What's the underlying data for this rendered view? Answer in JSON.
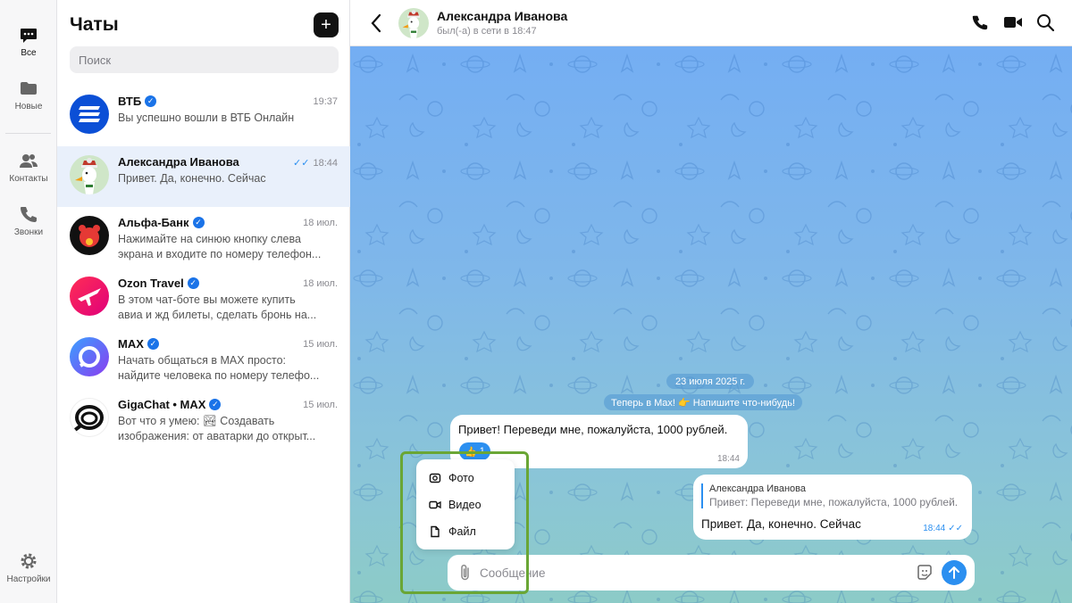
{
  "rail": {
    "items": [
      {
        "label": "Все",
        "icon": "chat-bubble-icon"
      },
      {
        "label": "Новые",
        "icon": "folder-icon"
      },
      {
        "label": "Контакты",
        "icon": "contacts-icon"
      },
      {
        "label": "Звонки",
        "icon": "phone-icon"
      }
    ],
    "settings_label": "Настройки"
  },
  "chats": {
    "title": "Чаты",
    "new_chat_symbol": "+",
    "search_placeholder": "Поиск",
    "items": [
      {
        "name": "ВТБ",
        "time": "19:37",
        "preview": "Вы успешно вошли в ВТБ Онлайн",
        "verified": true
      },
      {
        "name": "Александра Иванова",
        "time": "18:44",
        "preview": "Привет. Да, конечно. Сейчас",
        "verified": false,
        "read": true
      },
      {
        "name": "Альфа-Банк",
        "time": "18 июл.",
        "preview": "Нажимайте на синюю кнопку слева\nэкрана и входите по номеру телефон...",
        "verified": true
      },
      {
        "name": "Ozon Travel",
        "time": "18 июл.",
        "preview": "В этом чат-боте вы можете купить\nавиа и жд билеты, сделать бронь на...",
        "verified": true
      },
      {
        "name": "MAX",
        "time": "15 июл.",
        "preview": "Начать общаться в MAX просто:\nнайдите человека по номеру телефо...",
        "verified": true
      },
      {
        "name": "GigaChat • MAX",
        "time": "15 июл.",
        "preview": "Вот что я умею: 🏞 Создавать\nизображения: от аватарки до открыт...",
        "verified": true
      }
    ]
  },
  "conversation": {
    "name": "Александра Иванова",
    "status": "был(-а) в сети в 18:47",
    "date_pill": "23 июля 2025 г.",
    "system_message": "Теперь в Max! 👉 Напишите что-нибудь!",
    "incoming": {
      "text": "Привет! Переведи мне, пожалуйста, 1000 рублей.",
      "reaction": "👍",
      "reaction_count": "1",
      "time": "18:44"
    },
    "outgoing": {
      "reply_author": "Александра Иванова",
      "reply_text": "Привет: Переведи мне, пожалуйста, 1000 рублей.",
      "text": "Привет. Да, конечно. Сейчас",
      "time": "18:44"
    }
  },
  "attach_menu": {
    "items": [
      "Фото",
      "Видео",
      "Файл"
    ]
  },
  "composer": {
    "placeholder": "Сообщение"
  },
  "colors": {
    "accent": "#2b8ff0",
    "highlight": "#6aa635",
    "active_row": "#e9f0fb"
  }
}
